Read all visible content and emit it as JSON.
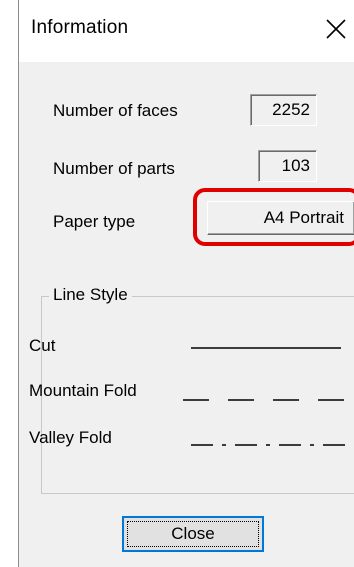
{
  "window": {
    "title": "Information",
    "close_glyph": "close-icon"
  },
  "fields": {
    "faces_label": "Number of faces",
    "faces_value": "2252",
    "parts_label": "Number of parts",
    "parts_value": "103",
    "paper_label": "Paper type",
    "paper_value": "A4 Portrait"
  },
  "line_style": {
    "legend": "Line Style",
    "items": [
      {
        "label": "Cut",
        "style": "solid"
      },
      {
        "label": "Mountain Fold",
        "style": "dashed"
      },
      {
        "label": "Valley Fold",
        "style": "dash-dot"
      }
    ]
  },
  "buttons": {
    "close_label": "Close"
  },
  "colors": {
    "highlight": "#e00000",
    "focus_border": "#0078d7",
    "client_bg": "#f0f0f0"
  }
}
